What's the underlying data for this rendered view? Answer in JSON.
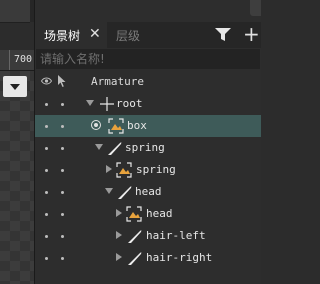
{
  "canvas": {
    "ruler_value": "700"
  },
  "tabs": [
    {
      "label": "场景树",
      "active": true
    },
    {
      "label": "层级",
      "active": false
    }
  ],
  "search": {
    "placeholder": "请输入名称!"
  },
  "tree": {
    "header": "Armature",
    "rows": [
      {
        "label": "root",
        "icon": "bone-cross-icon",
        "expanded": true,
        "selected": false
      },
      {
        "label": "box",
        "icon": "image-slot-icon",
        "selected": true
      },
      {
        "label": "spring",
        "icon": "bone-icon",
        "expanded": true,
        "selected": false
      },
      {
        "label": "spring",
        "icon": "image-slot-icon",
        "expanded": false,
        "selected": false
      },
      {
        "label": "head",
        "icon": "bone-icon",
        "expanded": true,
        "selected": false
      },
      {
        "label": "head",
        "icon": "image-slot-icon",
        "expanded": false,
        "selected": false
      },
      {
        "label": "hair-left",
        "icon": "bone-icon",
        "expanded": false,
        "selected": false
      },
      {
        "label": "hair-right",
        "icon": "bone-icon",
        "expanded": false,
        "selected": false
      }
    ]
  },
  "colors": {
    "selection": "#3e5b59",
    "accent": "#e8a33d"
  }
}
